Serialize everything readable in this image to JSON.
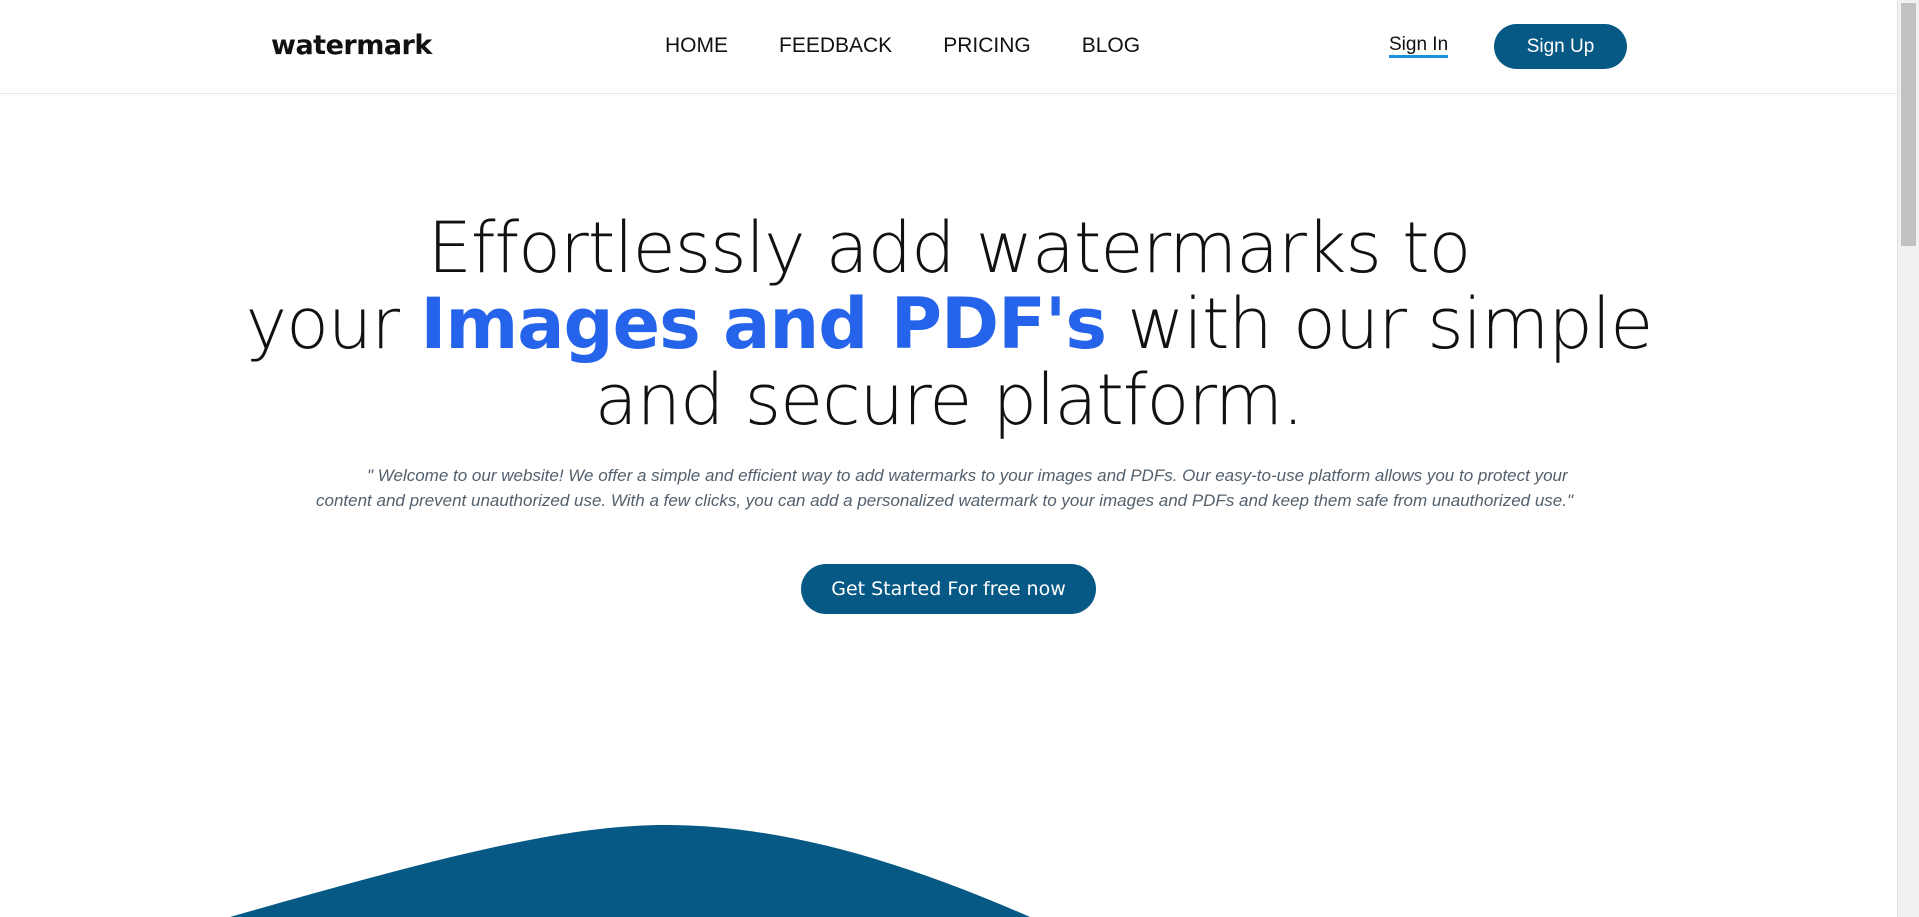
{
  "header": {
    "logo": "watermark",
    "nav": [
      "HOME",
      "FEEDBACK",
      "PRICING",
      "BLOG"
    ],
    "sign_in": "Sign In",
    "sign_up": "Sign Up"
  },
  "hero": {
    "line1": "Effortlessly add watermarks to",
    "line2_pre": "your ",
    "line2_accent": "Images and PDF's",
    "line2_post": " with our simple",
    "line3": "and secure platform.",
    "blurb": "\" Welcome to our website! We offer a simple and efficient way to add watermarks to your images and PDFs. Our easy-to-use platform allows you to protect your content and prevent unauthorized use. With a few clicks, you can add a personalized watermark to your images and PDFs and keep them safe from unauthorized use.\"",
    "cta": "Get Started For free now"
  },
  "colors": {
    "brand": "#075985",
    "accent": "#2563eb",
    "underline": "#1a8fe0"
  }
}
